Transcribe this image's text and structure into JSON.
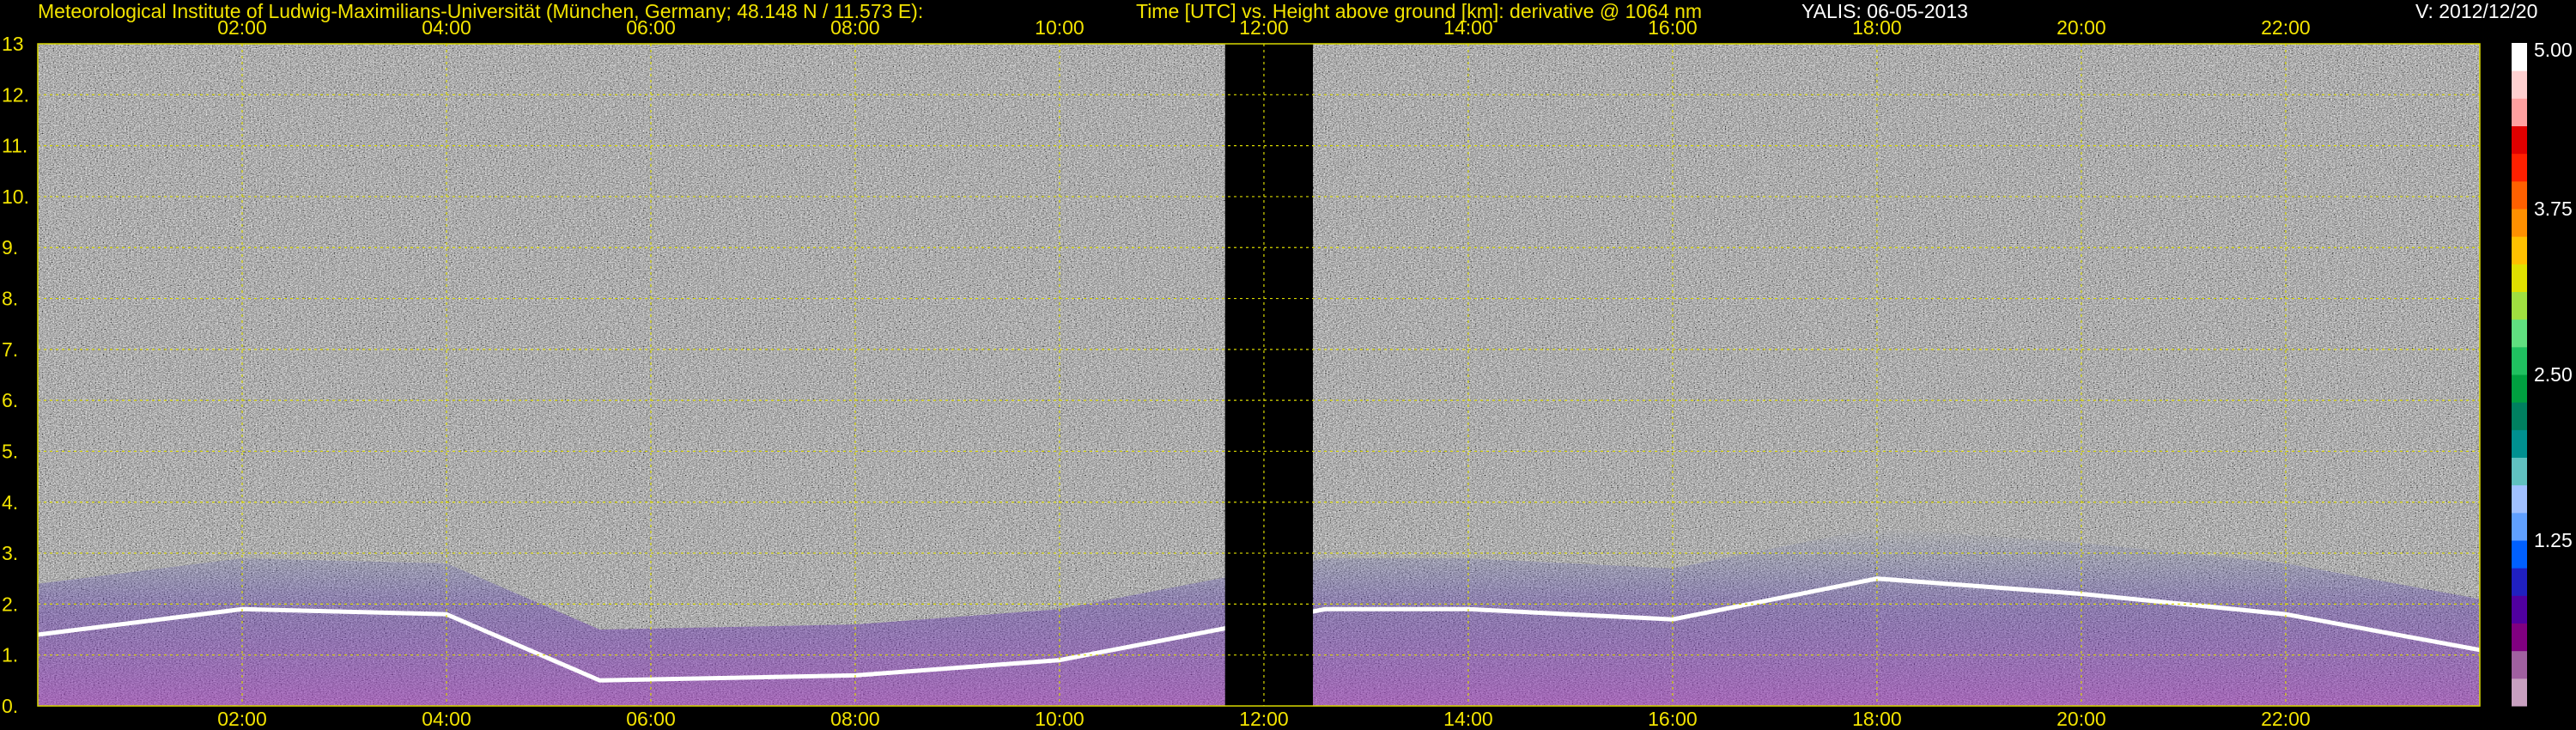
{
  "header": {
    "institute": "Meteorological Institute of Ludwig-Maximilians-Universität (München, Germany; 48.148 N / 11.573 E):",
    "plot_title": "Time [UTC] vs. Height above ground [km]: derivative @ 1064 nm",
    "instrument": "YALIS: 06-05-2013",
    "version": "V: 2012/12/20"
  },
  "chart_data": {
    "type": "heatmap",
    "xlabel": "Time [UTC]",
    "ylabel": "Height above ground [km]",
    "xlim": [
      0.0,
      23.9
    ],
    "ylim": [
      0,
      13
    ],
    "x_tick_labels": [
      "02:00",
      "04:00",
      "06:00",
      "08:00",
      "10:00",
      "12:00",
      "14:00",
      "16:00",
      "18:00",
      "20:00",
      "22:00"
    ],
    "x_tick_values": [
      2,
      4,
      6,
      8,
      10,
      12,
      14,
      16,
      18,
      20,
      22
    ],
    "y_tick_labels": [
      "0.",
      "1.",
      "2.",
      "3.",
      "4.",
      "5.",
      "6.",
      "7.",
      "8.",
      "9.",
      "10.",
      "11.",
      "12.",
      "13"
    ],
    "y_tick_values": [
      0,
      1,
      2,
      3,
      4,
      5,
      6,
      7,
      8,
      9,
      10,
      11,
      12,
      13
    ],
    "grid": true,
    "data_gap_hours": [
      11.62,
      12.48
    ],
    "boundary_layer_top_km": [
      {
        "t": 0.0,
        "h": 1.4
      },
      {
        "t": 2.0,
        "h": 1.9
      },
      {
        "t": 4.0,
        "h": 1.8
      },
      {
        "t": 5.5,
        "h": 0.5
      },
      {
        "t": 8.0,
        "h": 0.6
      },
      {
        "t": 10.0,
        "h": 0.9
      },
      {
        "t": 12.6,
        "h": 1.9
      },
      {
        "t": 14.0,
        "h": 1.9
      },
      {
        "t": 16.0,
        "h": 1.7
      },
      {
        "t": 18.0,
        "h": 2.5
      },
      {
        "t": 20.0,
        "h": 2.2
      },
      {
        "t": 22.0,
        "h": 1.8
      },
      {
        "t": 23.9,
        "h": 1.1
      }
    ],
    "colorbar": {
      "range": [
        0,
        5
      ],
      "tick_labels": [
        "1.25",
        "2.50",
        "3.75",
        "5.00"
      ],
      "tick_values": [
        1.25,
        2.5,
        3.75,
        5.0
      ],
      "colors": [
        "#c8a0c0",
        "#a060a0",
        "#800080",
        "#5000a0",
        "#2020c0",
        "#0060ff",
        "#60a0ff",
        "#a0c0ff",
        "#60c0c0",
        "#009090",
        "#008060",
        "#00a040",
        "#20c060",
        "#60e080",
        "#a0e040",
        "#e0e000",
        "#ffc000",
        "#ff9000",
        "#ff6000",
        "#ff2000",
        "#e00000",
        "#ffa0a0",
        "#ffd0d0",
        "#ffffff"
      ]
    }
  }
}
